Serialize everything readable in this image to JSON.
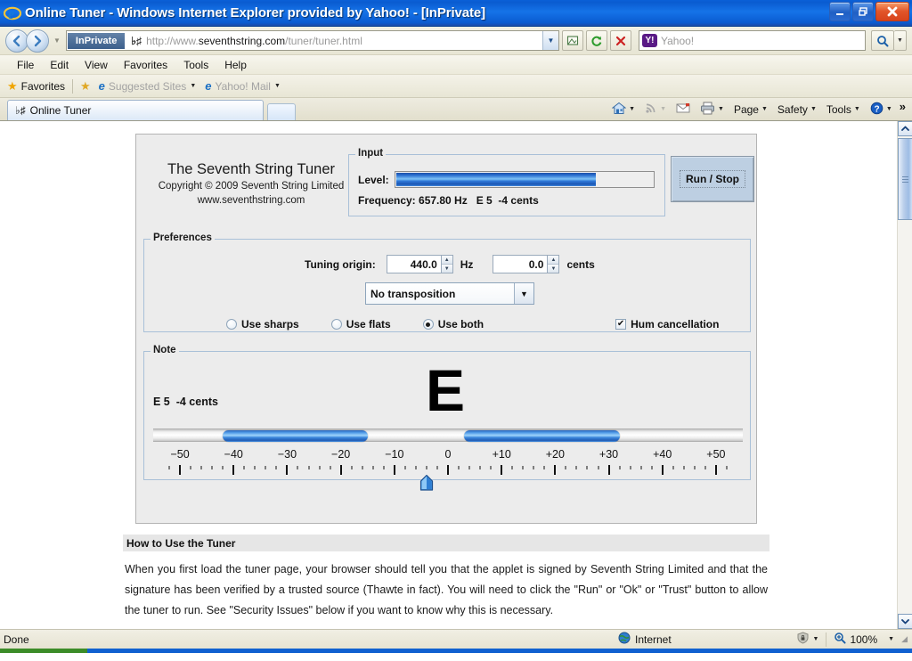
{
  "window": {
    "title": "Online Tuner - Windows Internet Explorer provided by Yahoo! - [InPrivate]",
    "minimize_label": "_",
    "restore_label": "❐",
    "close_label": "✕",
    "logo_icon": "ie-logo-icon"
  },
  "navigation": {
    "back_label": "◀",
    "forward_label": "▶",
    "recent_dropdown_label": "▼",
    "inprivate_badge": "InPrivate",
    "favicon_glyph": "♭♯",
    "url_prefix": "http://www.",
    "url_domain": "seventhstring.com",
    "url_path": "/tuner/tuner.html",
    "url_dropdown_label": "▼",
    "compat_icon": "compatibility-view-icon",
    "refresh_icon": "↻",
    "stop_icon": "✕"
  },
  "search": {
    "provider_mark": "Y!",
    "placeholder": "Yahoo!",
    "go_icon": "⌕",
    "options_label": "▼"
  },
  "menubar": {
    "items": [
      "File",
      "Edit",
      "View",
      "Favorites",
      "Tools",
      "Help"
    ]
  },
  "favorites_bar": {
    "favorites_label": "Favorites",
    "star_icon": "★",
    "add_to_favorites_icon": "★",
    "links": [
      {
        "label": "Suggested Sites",
        "icon": "ie-icon",
        "caret": "▼"
      },
      {
        "label": "Yahoo! Mail",
        "icon": "ie-icon",
        "caret": "▼"
      }
    ]
  },
  "tabs": {
    "items": [
      {
        "label": "Online Tuner",
        "icon_glyph": "♭♯"
      }
    ],
    "new_tab_label": ""
  },
  "command_bar": {
    "items": [
      {
        "label": "",
        "icon": "home-icon",
        "caret": "▼"
      },
      {
        "label": "",
        "icon": "feeds-icon",
        "caret": "▼"
      },
      {
        "label": "",
        "icon": "read-mail-icon",
        "caret": ""
      },
      {
        "label": "",
        "icon": "print-icon",
        "caret": "▼"
      },
      {
        "label": "Page",
        "icon": "",
        "caret": "▼"
      },
      {
        "label": "Safety",
        "icon": "",
        "caret": "▼"
      },
      {
        "label": "Tools",
        "icon": "",
        "caret": "▼"
      },
      {
        "label": "",
        "icon": "help-icon",
        "caret": "▼"
      }
    ],
    "overflow_label": "»"
  },
  "applet": {
    "brand": {
      "title": "The Seventh String Tuner",
      "copyright": "Copyright © 2009 Seventh String Limited",
      "website": "www.seventhstring.com"
    },
    "input_group": {
      "legend": "Input",
      "level_label": "Level:",
      "level_percent": 78,
      "frequency_line": "Frequency: 657.80 Hz   E 5  -4 cents"
    },
    "run_stop_label": "Run / Stop",
    "preferences_group": {
      "legend": "Preferences",
      "tuning_origin_label": "Tuning origin:",
      "tuning_hz_value": "440.0",
      "tuning_hz_unit": "Hz",
      "tuning_cents_value": "0.0",
      "tuning_cents_unit": "cents",
      "spin_up_glyph": "▲",
      "spin_down_glyph": "▼",
      "transposition_selected": "No transposition",
      "transposition_arrow": "▼",
      "radios": [
        {
          "label": "Use sharps",
          "selected": false
        },
        {
          "label": "Use flats",
          "selected": false
        },
        {
          "label": "Use both",
          "selected": true
        }
      ],
      "hum_cancellation_label": "Hum cancellation",
      "hum_cancellation_checked": true,
      "check_glyph": "✔"
    },
    "note_group": {
      "legend": "Note",
      "note_cents_text": "E 5  -4 cents",
      "note_letter": "E",
      "pointer_cents": -4
    }
  },
  "chart_data": {
    "type": "scatter",
    "title": "Cents deviation scale",
    "xlabel": "cents",
    "xlim": [
      -55,
      55
    ],
    "tick_labels": [
      "−50",
      "−40",
      "−30",
      "−20",
      "−10",
      "0",
      "+10",
      "+20",
      "+30",
      "+40",
      "+50"
    ],
    "tick_values": [
      -50,
      -40,
      -30,
      -20,
      -10,
      0,
      10,
      20,
      30,
      40,
      50
    ],
    "minor_tick_step": 2,
    "grid": false,
    "legend": "none",
    "pointer_value": -4,
    "meter_segments": [
      {
        "name": "left-bar",
        "start_cents": -42,
        "end_cents": -15
      },
      {
        "name": "right-bar",
        "start_cents": 3,
        "end_cents": 32
      }
    ]
  },
  "page_text": {
    "howto_heading": "How to Use the Tuner",
    "howto_body": "When you first load the tuner page, your browser should tell you that the applet is signed by Seventh String Limited and that the signature has been verified by a trusted source (Thawte in fact). You will need to click the \"Run\" or \"Ok\" or \"Trust\" button to allow the tuner to run. See \"Security Issues\" below if you want to know why this is necessary."
  },
  "status_bar": {
    "status_text": "Done",
    "zone_label": "Internet",
    "zone_icon": "globe-icon",
    "protected_mode_icon": "shield-icon",
    "protected_caret": "▼",
    "zoom_level": "100%",
    "zoom_icon": "magnifier-icon",
    "zoom_caret": "▼",
    "resize_grip": "◢"
  },
  "scrollbar": {
    "up_label": "▲",
    "down_label": "▼"
  }
}
